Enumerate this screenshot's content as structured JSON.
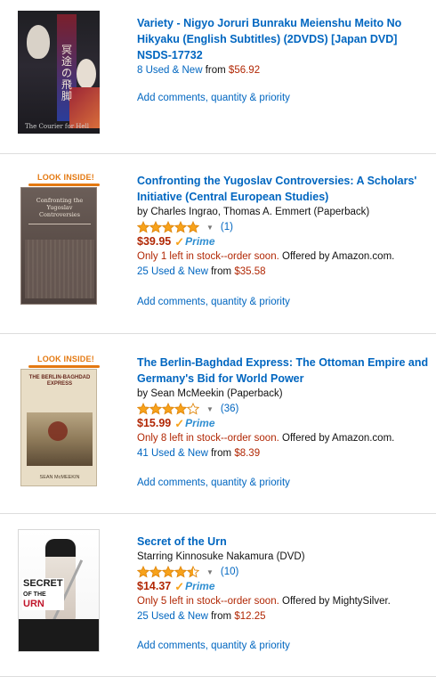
{
  "items": [
    {
      "title": "Variety - Nigyo Joruri Bunraku Meienshu Meito No Hikyaku (English Subtitles) (2DVDS) [Japan DVD] NSDS-17732",
      "offers_text": "8 Used & New",
      "offers_from": "from",
      "offers_price": "$56.92",
      "action": "Add comments, quantity & priority",
      "cover": {
        "jp_text": "冥途の飛脚",
        "foot_text": "The Courier for Hell"
      }
    },
    {
      "look_inside": "LOOK INSIDE!",
      "title": "Confronting the Yugoslav Controversies: A Scholars' Initiative (Central European Studies)",
      "byline": "by Charles Ingrao, Thomas A. Emmert (Paperback)",
      "rating": 5,
      "rating_count": "(1)",
      "price": "$39.95",
      "prime": "Prime",
      "stock": "Only 1 left in stock--order soon.",
      "offered_by": "Offered by Amazon.com.",
      "offers_text": "25 Used & New",
      "offers_from": "from",
      "offers_price": "$35.58",
      "action": "Add comments, quantity & priority",
      "cover": {
        "text": "Confronting the Yugoslav Controversies"
      }
    },
    {
      "look_inside": "LOOK INSIDE!",
      "title": "The Berlin-Baghdad Express: The Ottoman Empire and Germany's Bid for World Power",
      "byline": "by Sean McMeekin (Paperback)",
      "rating": 4,
      "rating_count": "(36)",
      "price": "$15.99",
      "prime": "Prime",
      "stock": "Only 8 left in stock--order soon.",
      "offered_by": "Offered by Amazon.com.",
      "offers_text": "41 Used & New",
      "offers_from": "from",
      "offers_price": "$8.39",
      "action": "Add comments, quantity & priority",
      "cover": {
        "text": "THE BERLIN-BAGHDAD EXPRESS",
        "author": "SEAN McMEEKIN"
      }
    },
    {
      "title": "Secret of the Urn",
      "byline": "Starring Kinnosuke Nakamura (DVD)",
      "rating": 4.5,
      "rating_count": "(10)",
      "price": "$14.37",
      "prime": "Prime",
      "stock": "Only 5 left in stock--order soon.",
      "offered_by": "Offered by MightySilver.",
      "offers_text": "25 Used & New",
      "offers_from": "from",
      "offers_price": "$12.25",
      "action": "Add comments, quantity & priority",
      "cover": {
        "line1": "SECRET",
        "line2": "OF THE",
        "line3": "URN"
      }
    }
  ],
  "colors": {
    "link": "#0066c0",
    "price": "#b12704",
    "star": "#f7a21b",
    "prime": "#2f8ed1"
  }
}
